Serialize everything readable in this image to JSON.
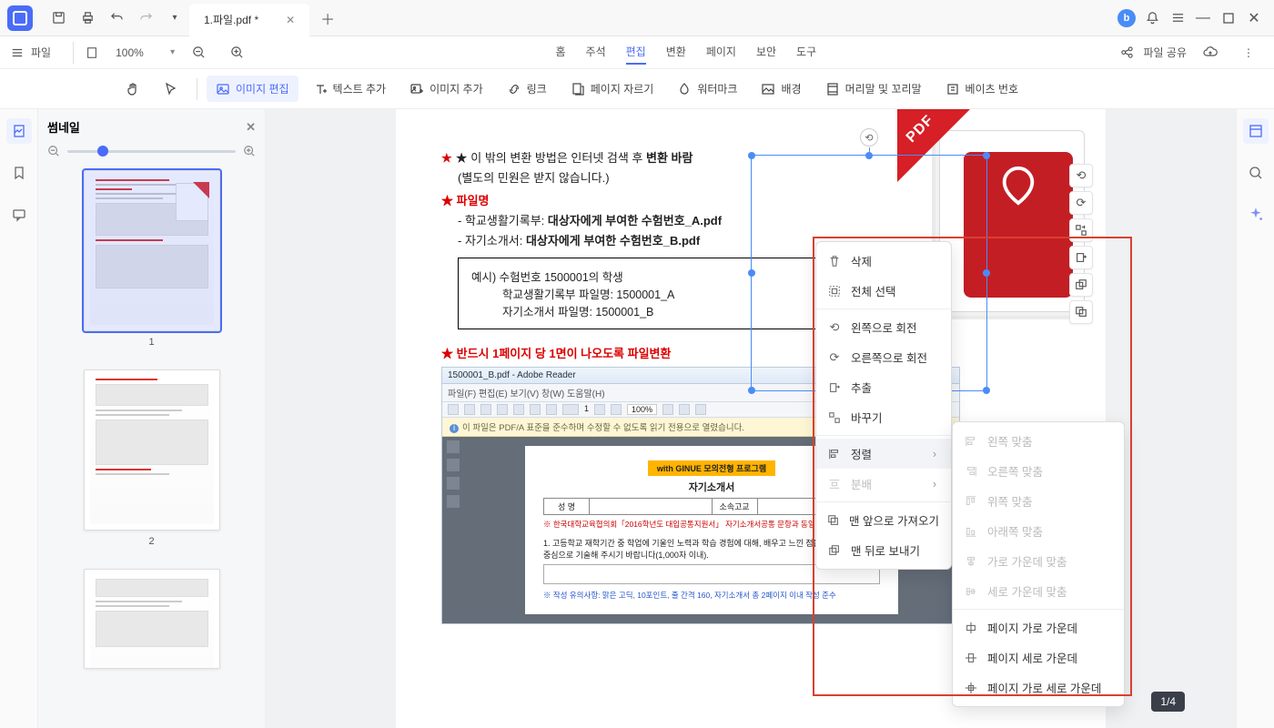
{
  "titlebar": {
    "tab_title": "1.파일.pdf *"
  },
  "menubar": {
    "file_label": "파일",
    "zoom": "100%",
    "tabs": [
      "홈",
      "주석",
      "편집",
      "변환",
      "페이지",
      "보안",
      "도구"
    ],
    "active_tab_index": 2,
    "share_label": "파일 공유"
  },
  "toolbar": {
    "image_edit": "이미지 편집",
    "text_add": "텍스트 추가",
    "image_add": "이미지 추가",
    "link": "링크",
    "page_crop": "페이지 자르기",
    "watermark": "워터마크",
    "background": "배경",
    "header_footer": "머리말 및 꼬리말",
    "bates": "베이츠 번호"
  },
  "thumb_panel": {
    "title": "썸네일",
    "pages": [
      "1",
      "2"
    ]
  },
  "doc": {
    "l1_prefix": "★ 이 밖의 변환 방법은 인터넷 검색 후 ",
    "l1_bold": "변환 바람",
    "l2": "(별도의 민원은 받지 않습니다.)",
    "l3_head": "★ 파일명",
    "l4_pre": "- 학교생활기록부: ",
    "l4_bold": "대상자에게 부여한 수험번호_A.pdf",
    "l5_pre": "- 자기소개서: ",
    "l5_bold": "대상자에게 부여한 수험번호_B.pdf",
    "ex1": "예시) 수험번호 1500001의 학생",
    "ex2": "학교생활기록부 파일명: 1500001_A",
    "ex3": "자기소개서 파일명: 1500001_B",
    "l6": "★ 반드시 1페이지 당 1면이 나오도록 파일변환",
    "embed_title": "1500001_B.pdf - Adobe Reader",
    "embed_menu": "파일(F)  편집(E)  보기(V)  창(W)  도움말(H)",
    "embed_zoom": "100%",
    "embed_note": "이 파일은 PDF/A 표준을 준수하며 수정할 수 없도록 읽기 전용으로 열렸습니다.",
    "banner": "with GINUE 모의전형 프로그램",
    "form_title": "자기소개서",
    "form_h1": "성   명",
    "form_h2": "소속고교",
    "form_note": "※ 한국대학교육협의회「2016학년도 대입공통지원서」 자기소개서공통 문항과 동일함",
    "form_body1": "1. 고등학교 재학기간 중 학업에 기울인 노력과 학습 경험에 대해, 배우고 느낀 점을",
    "form_body2": "   중심으로 기술해 주시기 바랍니다(1,000자 이내).",
    "blue_note": "※ 작성 유의사항: 맑은 고딕, 10포인트, 줄 간격 160, 자기소개서 총 2페이지 이내 작성 준수"
  },
  "context": {
    "delete": "삭제",
    "select_all": "전체 선택",
    "rotate_left": "왼쪽으로 회전",
    "rotate_right": "오른쪽으로 회전",
    "extract": "추출",
    "replace": "바꾸기",
    "align": "정렬",
    "distribute": "분배",
    "bring_front": "맨 앞으로 가져오기",
    "send_back": "맨 뒤로 보내기"
  },
  "align_sub": {
    "left": "왼쪽 맞춤",
    "right": "오른쪽 맞춤",
    "top": "위쪽 맞춤",
    "bottom": "아래쪽 맞춤",
    "hcenter": "가로 가운데 맞춤",
    "vcenter": "세로 가운데 맞춤",
    "page_h": "페이지 가로 가운데",
    "page_v": "페이지 세로 가운데",
    "page_hv": "페이지 가로 세로 가운데"
  },
  "page_indicator": "1/4",
  "pdf_ribbon": "PDF"
}
